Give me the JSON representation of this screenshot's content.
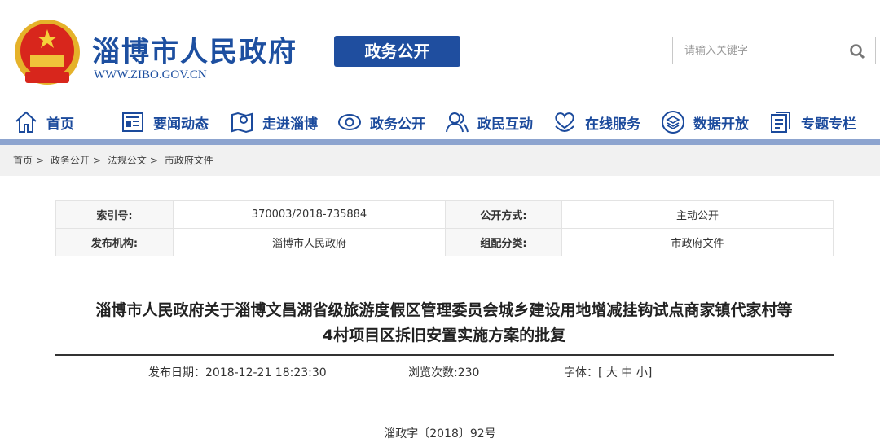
{
  "header": {
    "site_title": "淄博市人民政府",
    "site_url": "WWW.ZIBO.GOV.CN",
    "section_label": "政务公开",
    "search_placeholder": "请输入关键字"
  },
  "nav": [
    {
      "label": "首页",
      "icon": "home-icon"
    },
    {
      "label": "要闻动态",
      "icon": "news-icon"
    },
    {
      "label": "走进淄博",
      "icon": "map-icon"
    },
    {
      "label": "政务公开",
      "icon": "eye-icon"
    },
    {
      "label": "政民互动",
      "icon": "people-icon"
    },
    {
      "label": "在线服务",
      "icon": "heart-hand-icon"
    },
    {
      "label": "数据开放",
      "icon": "layers-icon"
    },
    {
      "label": "专题专栏",
      "icon": "document-icon"
    }
  ],
  "breadcrumb": [
    "首页",
    "政务公开",
    "法规公文",
    "市政府文件"
  ],
  "breadcrumb_sep": ">",
  "meta_table": {
    "index_label": "索引号:",
    "index_value": "370003/2018-735884",
    "open_label": "公开方式:",
    "open_value": "主动公开",
    "org_label": "发布机构:",
    "org_value": "淄博市人民政府",
    "cat_label": "组配分类:",
    "cat_value": "市政府文件"
  },
  "article": {
    "title_line1": "淄博市人民政府关于淄博文昌湖省级旅游度假区管理委员会城乡建设用地增减挂钩试点商家镇代家村等",
    "title_line2": "4村项目区拆旧安置实施方案的批复",
    "publish_date": "发布日期：2018-12-21 18:23:30",
    "views": "浏览次数:230",
    "font_label": "字体：[",
    "font_large": "大",
    "font_medium": "中",
    "font_small": "小",
    "font_close": "]",
    "doc_number": "淄政字〔2018〕92号"
  },
  "colors": {
    "brand": "#1d4fa0",
    "nav_line": "#8da4cf"
  }
}
